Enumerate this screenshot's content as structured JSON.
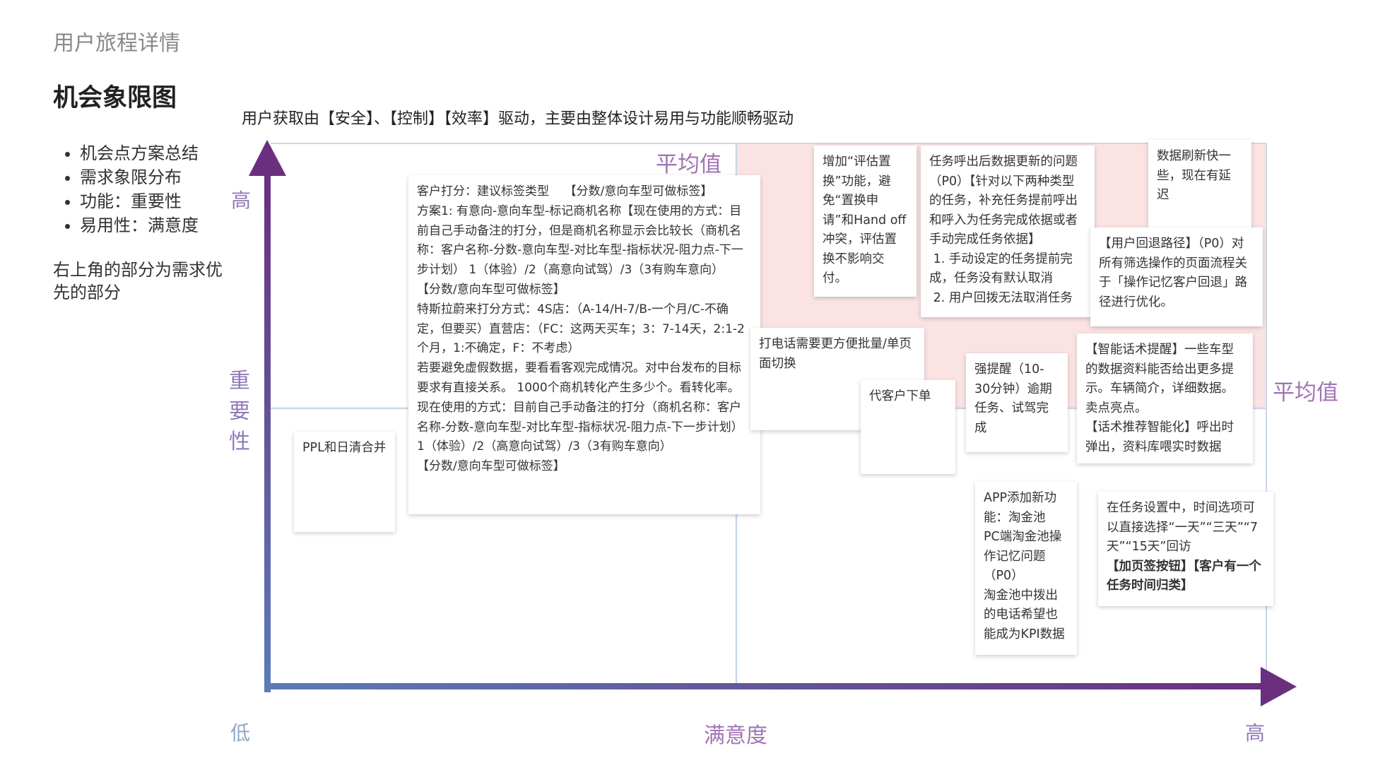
{
  "header": {
    "page_label": "用户旅程详情",
    "heading": "机会象限图",
    "subtitle": "用户获取由【安全】、【控制】【效率】驱动，主要由整体设计易用与功能顺畅驱动"
  },
  "sidebar": {
    "bullets": [
      "机会点方案总结",
      "需求象限分布",
      "功能：重要性",
      "易用性：满意度"
    ],
    "note": "右上角的部分为需求优先的部分"
  },
  "axes": {
    "y_high": "高",
    "y_label": "重要性",
    "x_low": "低",
    "x_label": "满意度",
    "x_high": "高",
    "average_top": "平均值",
    "average_right": "平均值"
  },
  "colors": {
    "axis_start": "#5b7bb8",
    "axis_end": "#6b2f7f",
    "highlight_quadrant": "#fbe3e3",
    "quadrant_line": "#c9d7ea"
  },
  "cards": [
    {
      "id": "ppl",
      "text": "PPL和日清合并"
    },
    {
      "id": "scoring",
      "text": "客户打分：建议标签类型    【分数/意向车型可做标签】\n方案1: 有意向-意向车型-标记商机名称【现在使用的方式：目前自己手动备注的打分，但是商机名称显示会比较长（商机名称：客户名称-分数-意向车型-对比车型-指标状况-阻力点-下一步计划） 1（体验）/2（高意向试驾）/3（3有购车意向）      【分数/意向车型可做标签】\n特斯拉蔚来打分方式：4S店：（A-14/H-7/B-一个月/C-不确定，但要买）直营店：（FC：这两天买车；3：7-14天，2:1-2个月，1:不确定，F：不考虑）\n若要避免虚假数据，要看看客观完成情况。对中台发布的目标要求有直接关系。 1000个商机转化产生多少个。看转化率。\n现在使用的方式：目前自己手动备注的打分（商机名称：客户名称-分数-意向车型-对比车型-指标状况-阻力点-下一步计划） 1（体验）/2（高意向试驾）/3（3有购车意向）\n【分数/意向车型可做标签】"
    },
    {
      "id": "batch_call",
      "text": "打电话需要更方便批量/单页面切换"
    },
    {
      "id": "proxy_order",
      "text": "代客户下单"
    },
    {
      "id": "evaluate_replace",
      "text": "增加“评估置换”功能，避免“置换申请”和Hand off冲突，评估置换不影响交付。"
    },
    {
      "id": "task_update",
      "text": "任务呼出后数据更新的问题（P0）【针对以下两种类型的任务，补充任务提前呼出和呼入为任务完成依据或者手动完成任务依据】\n 1. 手动设定的任务提前完成，任务没有默认取消\n 2. 用户回拨无法取消任务"
    },
    {
      "id": "data_refresh",
      "text": "数据刷新快一些，现在有延迟"
    },
    {
      "id": "user_back",
      "text": "【用户回退路径】（P0）对所有筛选操作的页面流程关于「操作记忆客户回退」路径进行优化。"
    },
    {
      "id": "strong_remind",
      "text": "强提醒（10-30分钟）逾期任务、试驾完成"
    },
    {
      "id": "smart_script",
      "text": "【智能话术提醒】一些车型的数据资料能否给出更多提示。车辆简介，详细数据。卖点亮点。\n【话术推荐智能化】呼出时弹出，资料库喂实时数据"
    },
    {
      "id": "app_pool",
      "text": "APP添加新功能：淘金池\nPC端淘金池操作记忆问题（P0）\n淘金池中拨出的电话希望也能成为KPI数据"
    },
    {
      "id": "task_time",
      "text": "在任务设置中，时间选项可以直接选择“一天”“三天”“7天”“15天”回访",
      "bold_text": "【加页签按钮】【客户有一个任务时间归类】"
    }
  ]
}
